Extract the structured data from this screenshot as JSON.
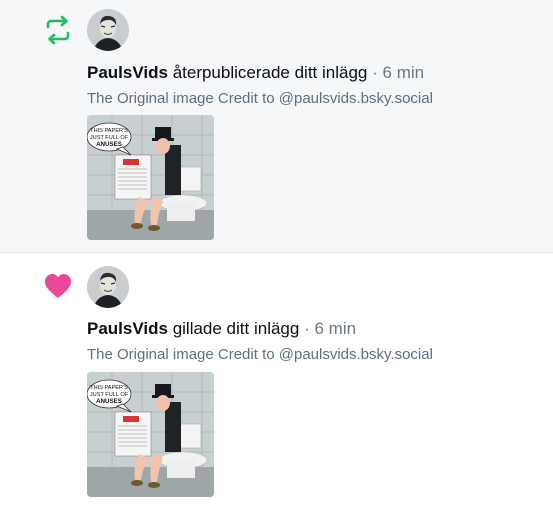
{
  "notifications": [
    {
      "kind_icon": "repost-icon",
      "author": "PaulsVids",
      "action": "återpublicerade ditt inlägg",
      "separator": "·",
      "time": "6 min",
      "post_text": "The Original image Credit to @paulsvids.bsky.social",
      "image": {
        "bubble_line1": "THIS PAPER'S",
        "bubble_line2": "JUST FULL OF",
        "bubble_line3": "ANUSES"
      }
    },
    {
      "kind_icon": "heart-icon",
      "author": "PaulsVids",
      "action": "gillade ditt inlägg",
      "separator": "·",
      "time": "6 min",
      "post_text": "The Original image Credit to @paulsvids.bsky.social",
      "image": {
        "bubble_line1": "THIS PAPER'S",
        "bubble_line2": "JUST FULL OF",
        "bubble_line3": "ANUSES"
      }
    }
  ],
  "colors": {
    "repost": "#20bc61",
    "like": "#ec4899",
    "muted": "#5f6f7e",
    "highlight_bg": "#f5f7f9"
  }
}
